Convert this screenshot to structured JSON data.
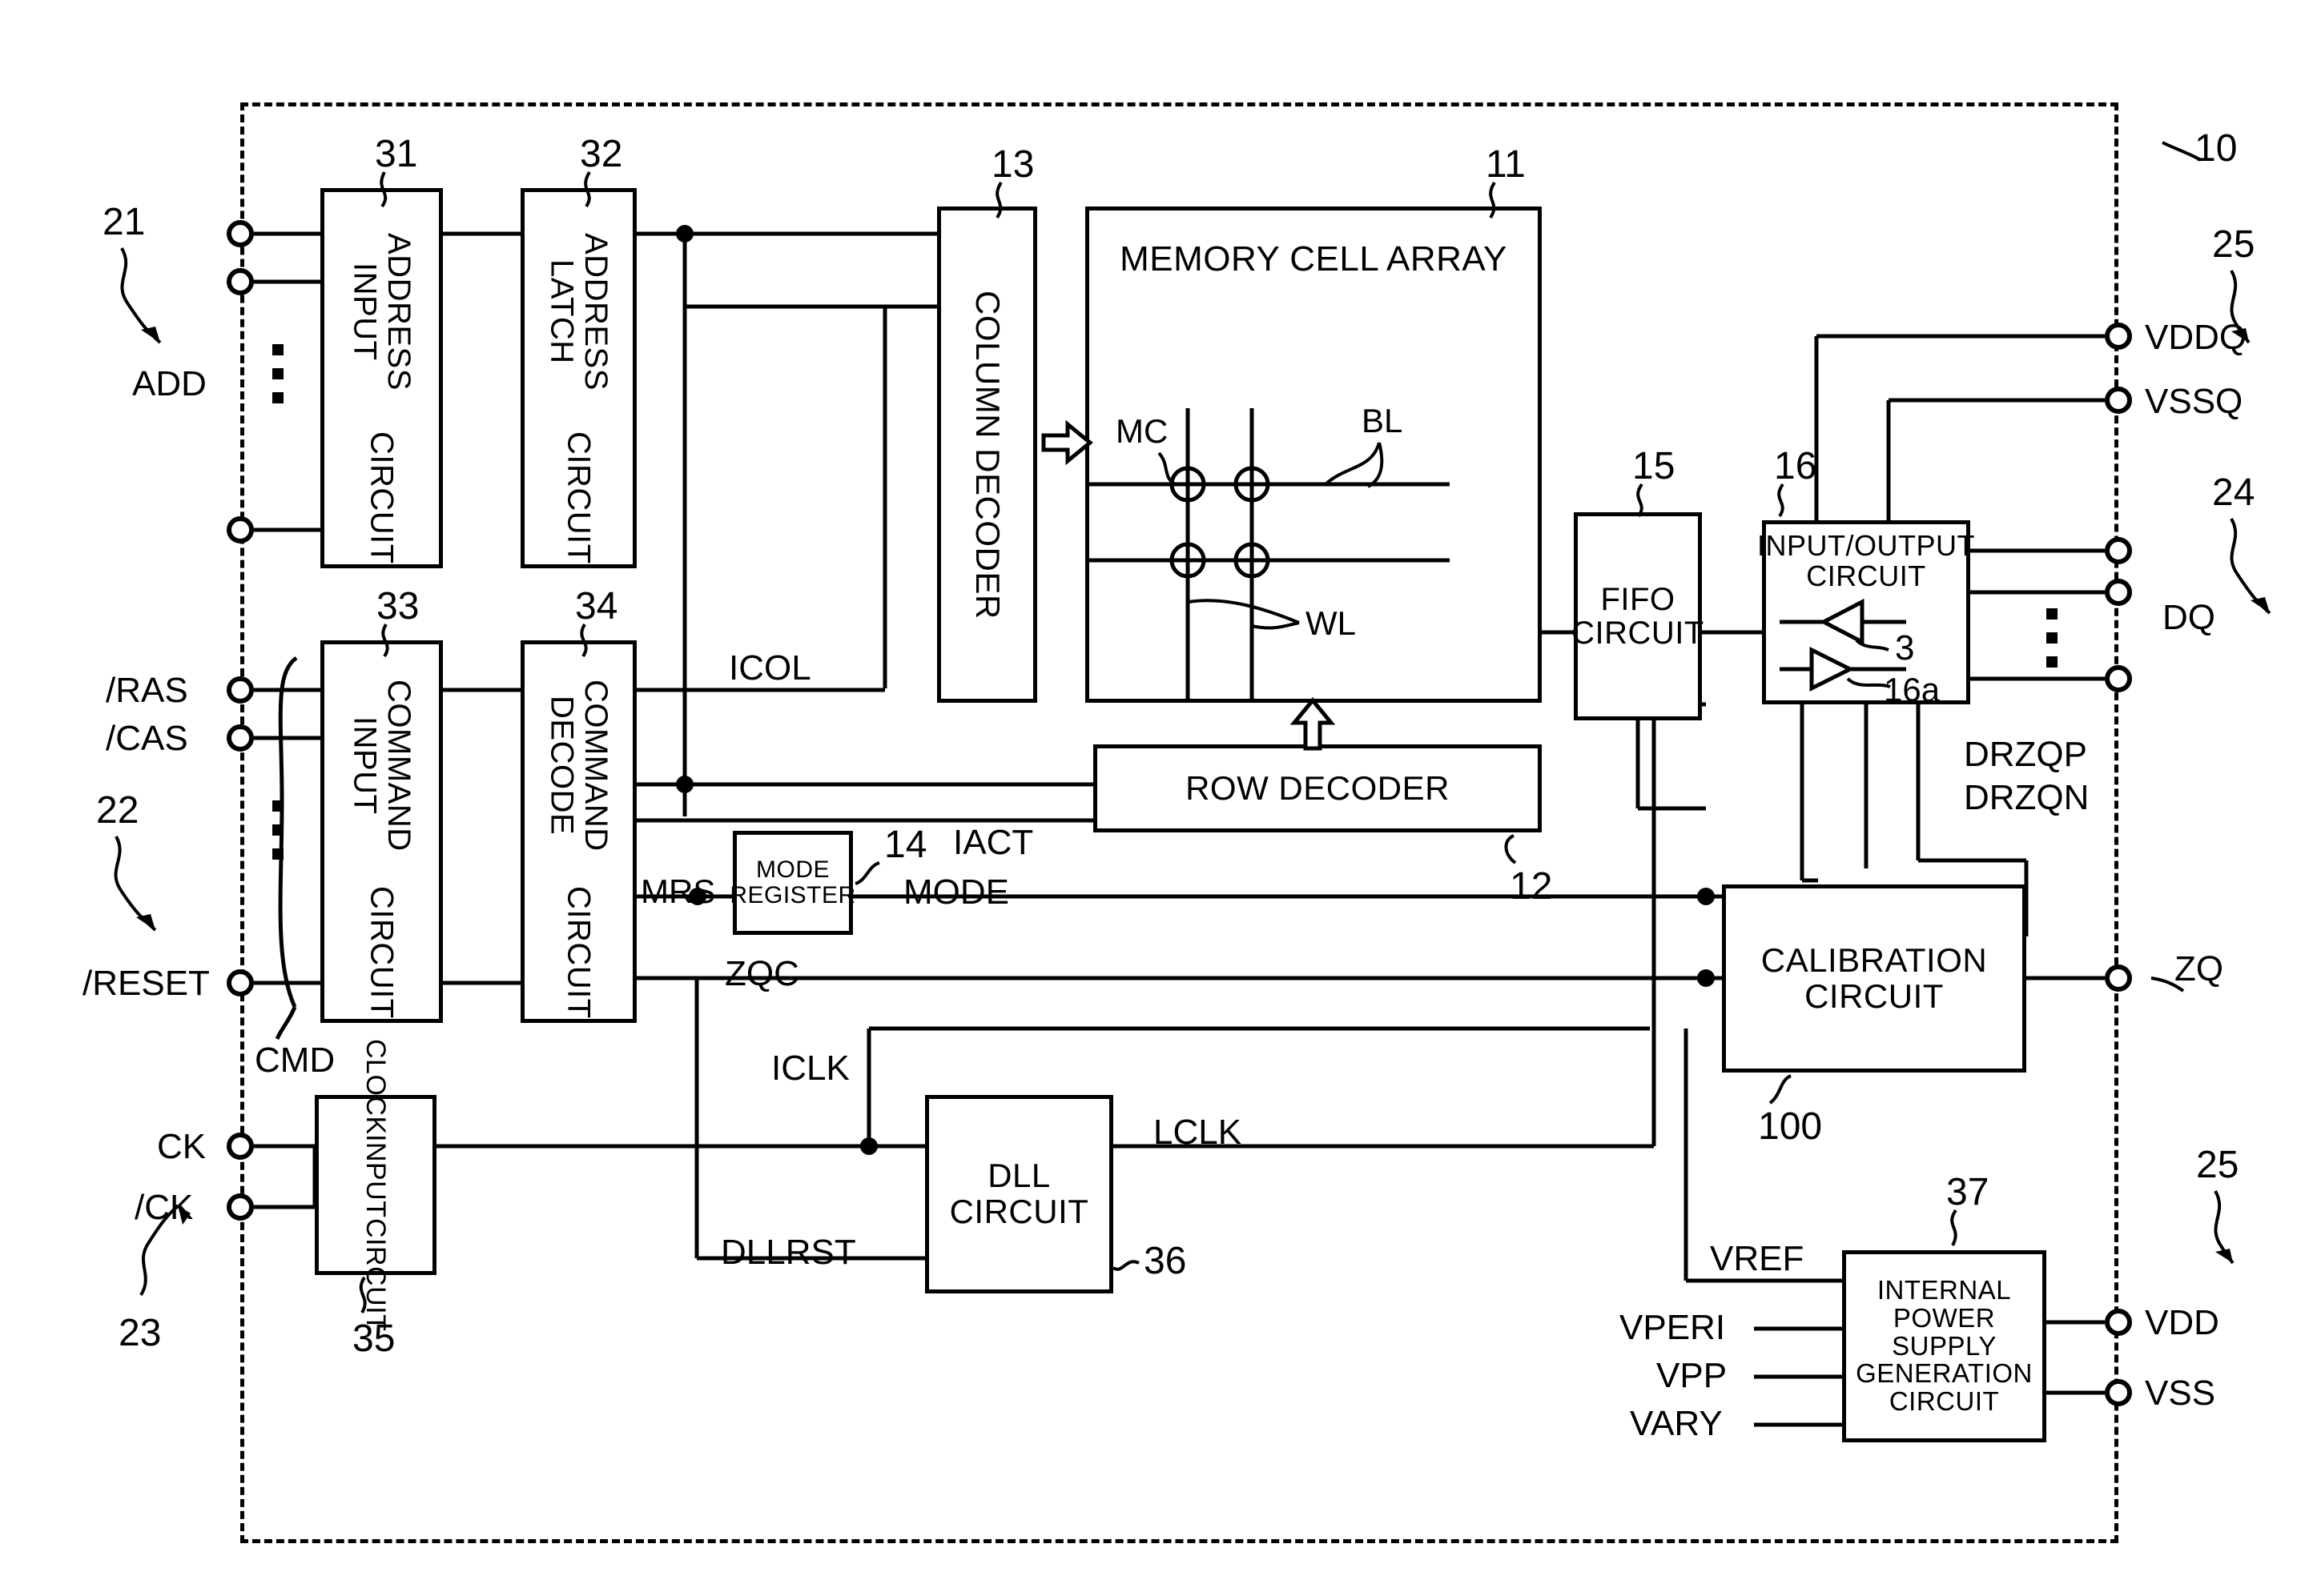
{
  "figure": {
    "kind": "semiconductor-block-diagram",
    "chip_ref": "10"
  },
  "blocks": {
    "address_input": {
      "label": "ADDRESS INPUT\nCIRCUIT",
      "line1": "ADDRESS INPUT",
      "line2": "CIRCUIT",
      "ref": "31"
    },
    "address_latch": {
      "line1": "ADDRESS LATCH",
      "line2": "CIRCUIT",
      "ref": "32"
    },
    "command_input": {
      "line1": "COMMAND INPUT",
      "line2": "CIRCUIT",
      "ref": "33"
    },
    "command_decode": {
      "line1": "COMMAND DECODE",
      "line2": "CIRCUIT",
      "ref": "34"
    },
    "clock_input": {
      "line1": "CLOCK",
      "line2": "INPUT",
      "line3": "CIRCUIT",
      "ref": "35"
    },
    "column_decoder": {
      "label": "COLUMN DECODER",
      "ref": "13"
    },
    "memory_cell_array": {
      "label": "MEMORY CELL ARRAY",
      "ref": "11"
    },
    "row_decoder": {
      "label": "ROW DECODER",
      "ref": "12"
    },
    "mode_register": {
      "line1": "MODE",
      "line2": "REGISTER",
      "ref": "14"
    },
    "fifo": {
      "line1": "FIFO",
      "line2": "CIRCUIT",
      "ref": "15"
    },
    "input_output": {
      "line1": "INPUT/OUTPUT",
      "line2": "CIRCUIT",
      "ref": "16",
      "driver_ref": "16a",
      "amp_ref": "3"
    },
    "calibration": {
      "line1": "CALIBRATION",
      "line2": "CIRCUIT",
      "ref": "100"
    },
    "dll": {
      "line1": "DLL",
      "line2": "CIRCUIT",
      "ref": "36"
    },
    "power_supply": {
      "line1": "INTERNAL",
      "line2": "POWER",
      "line3": "SUPPLY",
      "line4": "GENERATION",
      "line5": "CIRCUIT",
      "ref": "37"
    }
  },
  "groups": {
    "address_terminals_ref": "21",
    "command_terminals_ref": "22",
    "clock_terminals_ref": "23",
    "data_terminals_ref": "24",
    "power_terminals_top_ref": "25",
    "power_terminals_bottom_ref": "25"
  },
  "pins": {
    "add": "ADD",
    "ras": "/RAS",
    "cas": "/CAS",
    "reset": "/RESET",
    "ck": "CK",
    "ckb": "/CK",
    "vddq": "VDDQ",
    "vssq": "VSSQ",
    "dq": "DQ",
    "zq": "ZQ",
    "vdd": "VDD",
    "vss": "VSS"
  },
  "signals": {
    "cmd": "CMD",
    "icol": "ICOL",
    "iact": "IACT",
    "mrs": "MRS",
    "mode": "MODE",
    "zqc": "ZQC",
    "iclk": "ICLK",
    "lclk": "LCLK",
    "dllrst": "DLLRST",
    "drzqp": "DRZQP",
    "drzqn": "DRZQN",
    "vref": "VREF",
    "vperi": "VPERI",
    "vpp": "VPP",
    "vary": "VARY"
  },
  "array_labels": {
    "mc": "MC",
    "bl": "BL",
    "wl": "WL"
  },
  "colors": {
    "ink": "#000000",
    "paper": "#ffffff"
  }
}
